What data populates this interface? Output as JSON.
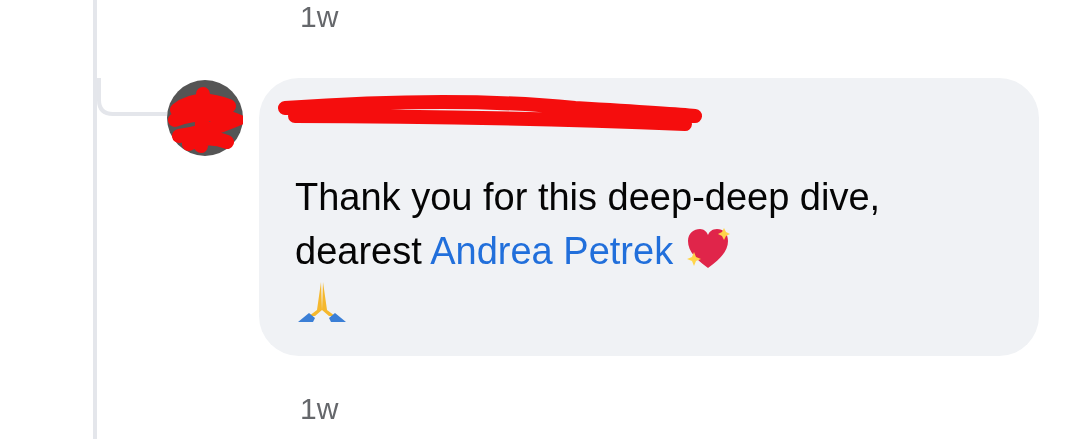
{
  "previous_comment": {
    "time": "1w"
  },
  "comment": {
    "text": "Thank you for this deep-deep dive, dearest",
    "mention": "Andrea Petrek",
    "time": "1w",
    "author_redacted": true
  }
}
